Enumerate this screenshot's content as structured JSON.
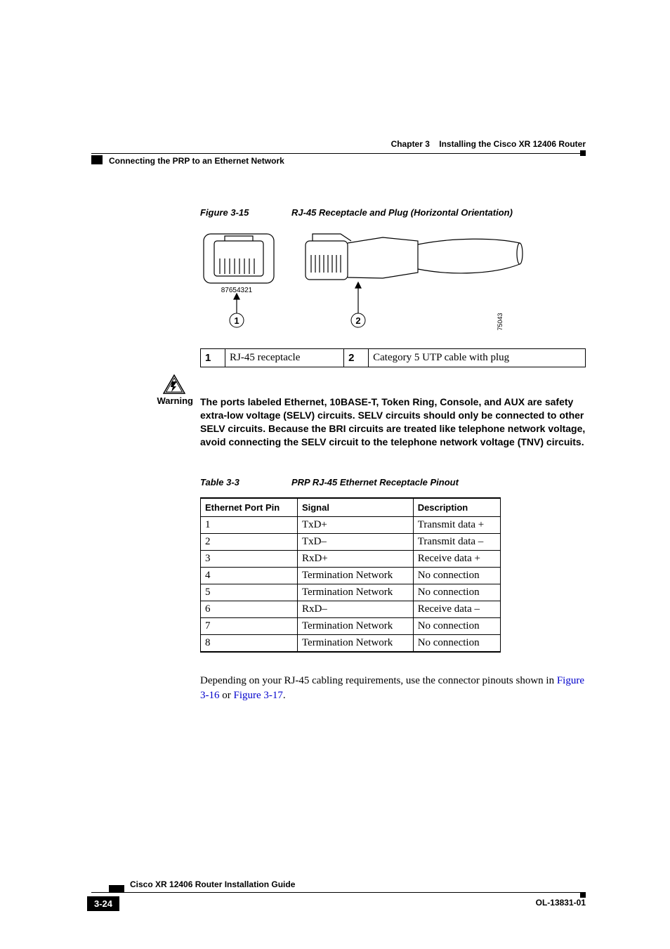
{
  "header": {
    "chapter_label": "Chapter 3",
    "chapter_title": "Installing the Cisco XR 12406 Router",
    "section_title": "Connecting the PRP to an Ethernet Network"
  },
  "figure": {
    "label": "Figure 3-15",
    "title": "RJ-45 Receptacle and Plug (Horizontal Orientation)",
    "pin_labels": "87654321",
    "callout_1": "1",
    "callout_2": "2",
    "drawing_id": "75043",
    "legend": [
      {
        "num": "1",
        "text": "RJ-45 receptacle"
      },
      {
        "num": "2",
        "text": "Category 5 UTP cable with plug"
      }
    ]
  },
  "warning": {
    "label": "Warning",
    "text": "The ports labeled Ethernet, 10BASE-T, Token Ring, Console, and AUX are safety extra-low voltage (SELV) circuits. SELV circuits should only be connected to other SELV circuits. Because the BRI circuits are treated like telephone network voltage, avoid connecting the SELV circuit to the telephone network voltage (TNV) circuits."
  },
  "table": {
    "label": "Table 3-3",
    "title": "PRP RJ-45 Ethernet Receptacle Pinout",
    "headers": {
      "col1": "Ethernet Port Pin",
      "col2": "Signal",
      "col3": "Description"
    },
    "rows": [
      {
        "pin": "1",
        "signal": "TxD+",
        "desc": "Transmit data +"
      },
      {
        "pin": "2",
        "signal": "TxD–",
        "desc": "Transmit data –"
      },
      {
        "pin": "3",
        "signal": "RxD+",
        "desc": "Receive data +"
      },
      {
        "pin": "4",
        "signal": "Termination Network",
        "desc": "No connection"
      },
      {
        "pin": "5",
        "signal": "Termination Network",
        "desc": "No connection"
      },
      {
        "pin": "6",
        "signal": "RxD–",
        "desc": "Receive data –"
      },
      {
        "pin": "7",
        "signal": "Termination Network",
        "desc": "No connection"
      },
      {
        "pin": "8",
        "signal": "Termination Network",
        "desc": "No connection"
      }
    ]
  },
  "body": {
    "para_pre": "Depending on your RJ-45 cabling requirements, use the connector pinouts shown in ",
    "link1": "Figure 3-16",
    "or": " or ",
    "link2": "Figure 3-17",
    "period": "."
  },
  "footer": {
    "guide_title": "Cisco XR 12406 Router Installation Guide",
    "page_num": "3-24",
    "doc_id": "OL-13831-01"
  }
}
